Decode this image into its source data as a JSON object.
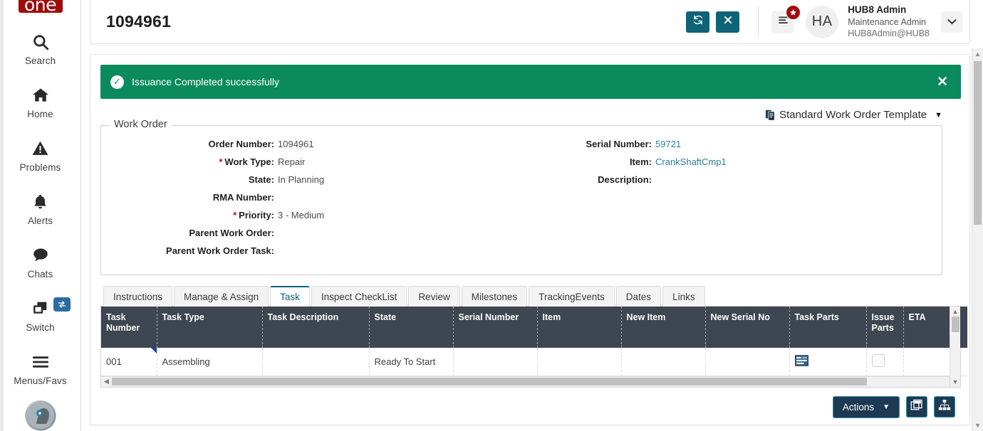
{
  "brand": {
    "logo_text": "one",
    "accent_teal": "#0e6377",
    "accent_red": "#a00c0c",
    "accent_green": "#0b8a5e",
    "accent_navy": "#1d3a52"
  },
  "rail": {
    "items": [
      {
        "label": "Search",
        "icon": "search-icon"
      },
      {
        "label": "Home",
        "icon": "home-icon"
      },
      {
        "label": "Problems",
        "icon": "warning-triangle-icon"
      },
      {
        "label": "Alerts",
        "icon": "bell-icon"
      },
      {
        "label": "Chats",
        "icon": "chat-bubble-icon"
      },
      {
        "label": "Switch",
        "icon": "windows-stack-icon"
      },
      {
        "label": "Menus/Favs",
        "icon": "hamburger-icon"
      }
    ],
    "switch_badge_icon": "exchange-arrows-icon",
    "assistant_avatar": "assistant-avatar-icon"
  },
  "header": {
    "work_order_number": "1094961",
    "refresh_icon": "refresh-icon",
    "close_icon": "close-icon",
    "menu_icon": "hamburger-icon",
    "star_badge_icon": "star-icon",
    "avatar_initials": "HA",
    "user_name": "HUB8 Admin",
    "user_role": "Maintenance Admin",
    "user_email": "HUB8Admin@HUB8",
    "caret_icon": "chevron-down-icon"
  },
  "alert": {
    "message": "Issuance Completed successfully",
    "check_icon": "check-circle-icon",
    "close_icon": "close-icon"
  },
  "template": {
    "label": "Standard Work Order Template",
    "doc_icon": "documents-icon",
    "caret_icon": "caret-down-icon"
  },
  "work_order": {
    "legend": "Work Order",
    "left_fields": [
      {
        "label": "Order Number:",
        "value": "1094961",
        "required": false,
        "link": false
      },
      {
        "label": "Work Type:",
        "value": "Repair",
        "required": true,
        "link": false
      },
      {
        "label": "State:",
        "value": "In Planning",
        "required": false,
        "link": false
      },
      {
        "label": "RMA Number:",
        "value": "",
        "required": false,
        "link": false
      },
      {
        "label": "Priority:",
        "value": "3 - Medium",
        "required": true,
        "link": false
      },
      {
        "label": "Parent Work Order:",
        "value": "",
        "required": false,
        "link": false
      },
      {
        "label": "Parent Work Order Task:",
        "value": "",
        "required": false,
        "link": false
      }
    ],
    "right_fields": [
      {
        "label": "Serial Number:",
        "value": "59721",
        "required": false,
        "link": true
      },
      {
        "label": "Item:",
        "value": "CrankShaftCmp1",
        "required": false,
        "link": true
      },
      {
        "label": "Description:",
        "value": "",
        "required": false,
        "link": false
      }
    ]
  },
  "tabs": [
    {
      "label": "Instructions",
      "active": false
    },
    {
      "label": "Manage & Assign",
      "active": false
    },
    {
      "label": "Task",
      "active": true
    },
    {
      "label": "Inspect CheckList",
      "active": false
    },
    {
      "label": "Review",
      "active": false
    },
    {
      "label": "Milestones",
      "active": false
    },
    {
      "label": "TrackingEvents",
      "active": false
    },
    {
      "label": "Dates",
      "active": false
    },
    {
      "label": "Links",
      "active": false
    }
  ],
  "task_table": {
    "columns": [
      "Task Number",
      "Task Type",
      "Task Description",
      "State",
      "Serial Number",
      "Item",
      "New Item",
      "New Serial No",
      "Task Parts",
      "Issue Parts",
      "ETA"
    ],
    "rows": [
      {
        "task_number": "001",
        "task_type": "Assembling",
        "task_description": "",
        "state": "Ready To Start",
        "serial_number": "",
        "item": "",
        "new_item": "",
        "new_serial_no": "",
        "task_parts_icon": "task-parts-list-icon",
        "issue_parts_checked": false,
        "eta": ""
      }
    ]
  },
  "footer": {
    "actions_label": "Actions",
    "actions_caret": "caret-down-icon",
    "copy_window_icon": "window-copy-icon",
    "hierarchy_icon": "hierarchy-tree-icon"
  }
}
